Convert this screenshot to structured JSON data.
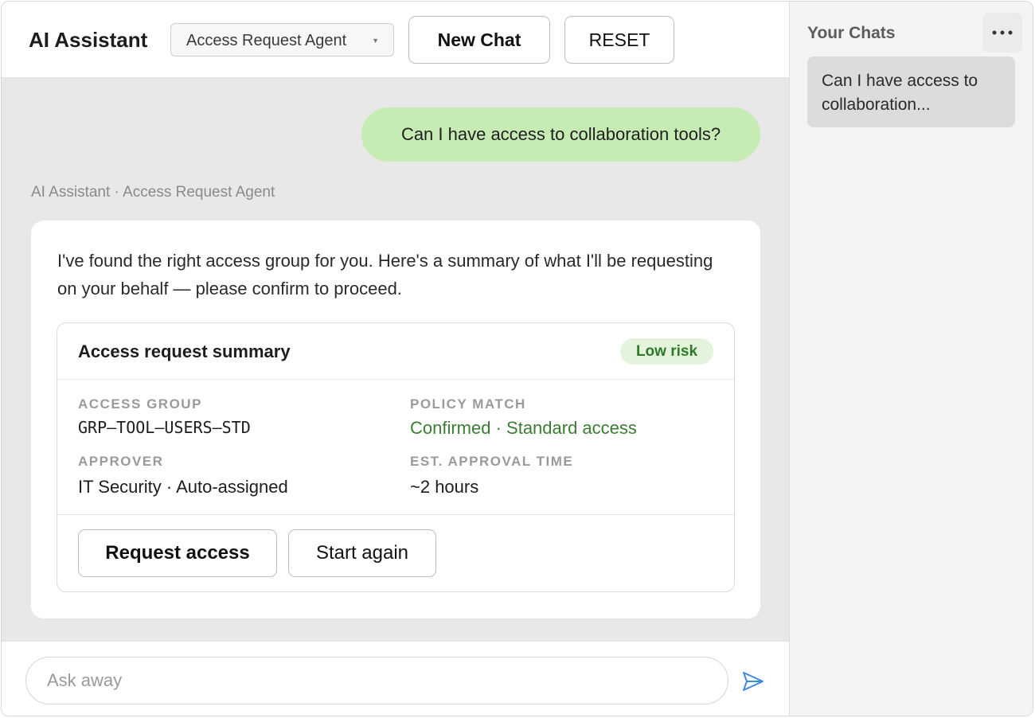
{
  "header": {
    "app_title": "AI Assistant",
    "agent_select_value": "Access Request Agent",
    "new_chat_label": "New Chat",
    "reset_label": "RESET"
  },
  "conversation": {
    "user_message": "Can I have access to collaboration tools?",
    "sender_line": "AI Assistant · Access Request Agent",
    "assistant_intro": "I've found the right access group for you. Here's a summary of what I'll be requesting on your behalf — please confirm to proceed.",
    "summary": {
      "title": "Access request summary",
      "risk_badge": "Low risk",
      "access_group_label": "ACCESS GROUP",
      "access_group_value": "GRP–TOOL–USERS–STD",
      "policy_match_label": "POLICY MATCH",
      "policy_match_value": "Confirmed · Standard access",
      "approver_label": "APPROVER",
      "approver_value": "IT Security · Auto-assigned",
      "approval_time_label": "EST. APPROVAL TIME",
      "approval_time_value": "~2 hours",
      "request_button": "Request access",
      "start_again_button": "Start again"
    }
  },
  "composer": {
    "placeholder": "Ask away"
  },
  "sidebar": {
    "title": "Your Chats",
    "chats": [
      {
        "label": "Can I have access to collaboration..."
      }
    ]
  },
  "colors": {
    "user_bubble": "#c6ecb4",
    "conversation_bg": "#e8e8e8",
    "risk_green": "#3b7d32",
    "send_icon": "#3d8be0"
  },
  "icons": {
    "send": "send-icon",
    "more": "more-dots-icon",
    "dropdown": "chevron-down-icon"
  }
}
